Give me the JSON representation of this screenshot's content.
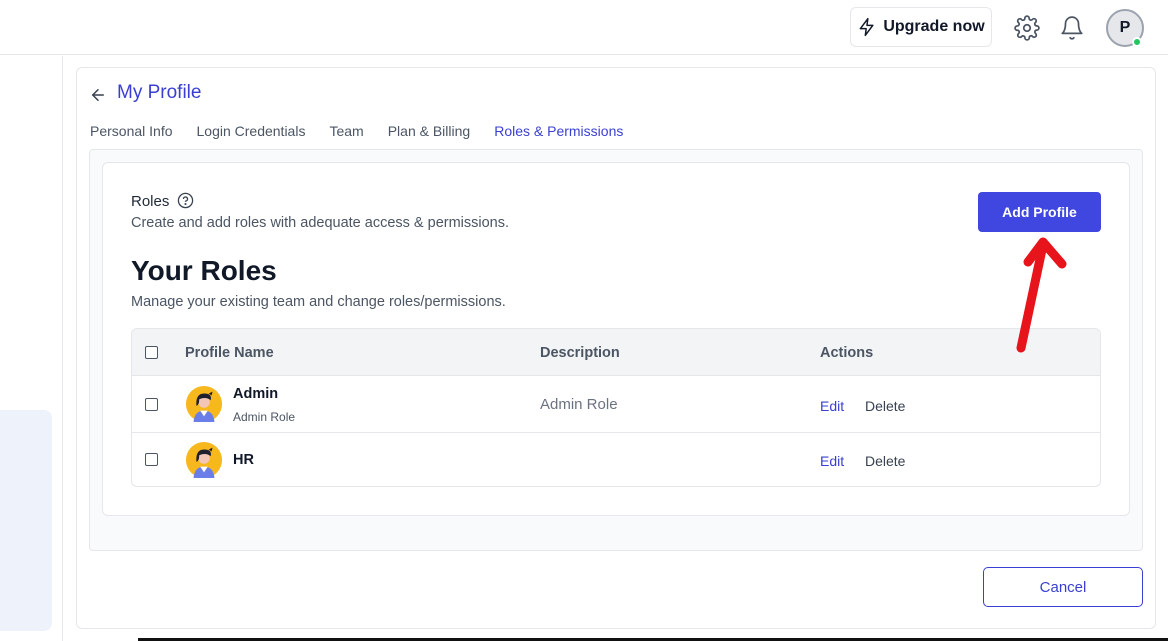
{
  "topbar": {
    "upgrade_label": "Upgrade now",
    "avatar_initial": "P"
  },
  "header": {
    "title": "My Profile"
  },
  "tabs": [
    {
      "label": "Personal Info",
      "active": false
    },
    {
      "label": "Login Credentials",
      "active": false
    },
    {
      "label": "Team",
      "active": false
    },
    {
      "label": "Plan & Billing",
      "active": false
    },
    {
      "label": "Roles & Permissions",
      "active": true
    }
  ],
  "roles_section": {
    "label": "Roles",
    "description": "Create and add roles with adequate access & permissions.",
    "add_button": "Add Profile"
  },
  "your_roles": {
    "title": "Your Roles",
    "description": "Manage your existing team and change roles/permissions."
  },
  "table": {
    "headers": {
      "profile_name": "Profile Name",
      "description": "Description",
      "actions": "Actions"
    },
    "rows": [
      {
        "name": "Admin",
        "subtitle": "Admin Role",
        "description": "Admin Role",
        "edit": "Edit",
        "delete": "Delete"
      },
      {
        "name": "HR",
        "subtitle": "",
        "description": "",
        "edit": "Edit",
        "delete": "Delete"
      }
    ]
  },
  "footer": {
    "cancel_label": "Cancel"
  },
  "colors": {
    "accent": "#4046e0",
    "link": "#3b3fd1",
    "online": "#22c55e",
    "annotation": "#e8141c"
  },
  "icons": [
    "lightning-icon",
    "gear-icon",
    "bell-icon",
    "back-arrow-icon",
    "help-circle-icon",
    "user-avatar-icon"
  ]
}
